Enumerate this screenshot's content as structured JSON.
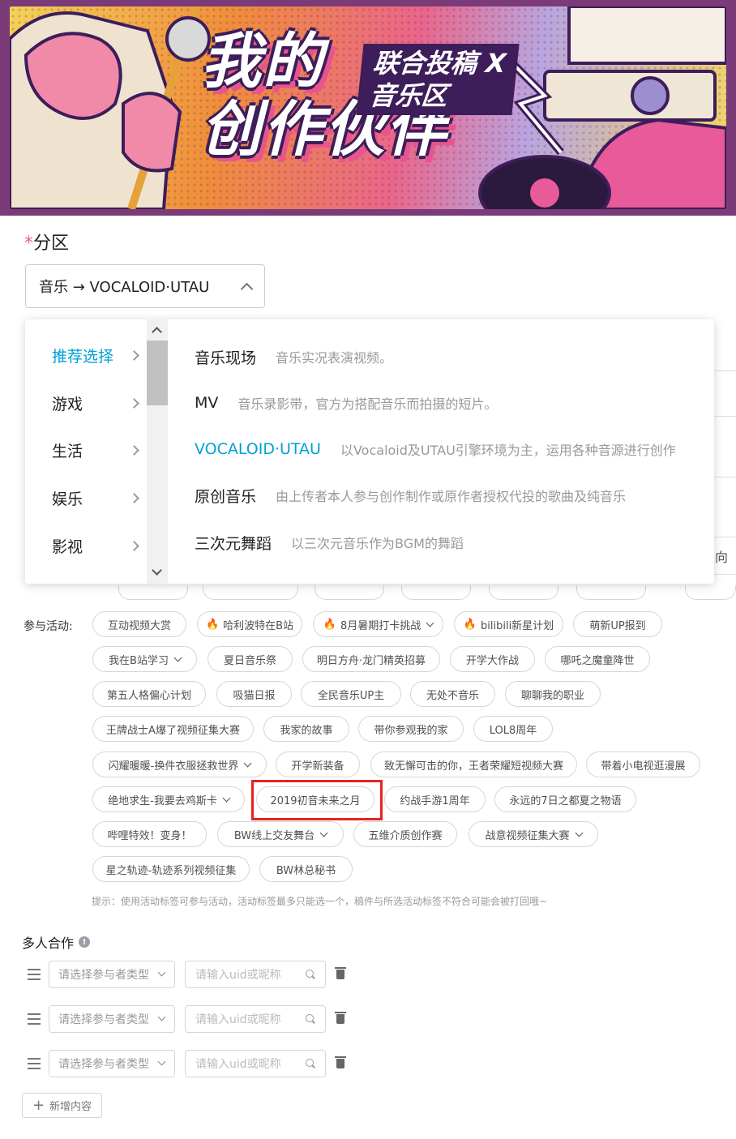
{
  "banner": {
    "title_main": "我的\n创作伙伴",
    "title_sub": "联合投稿 X\n音乐区"
  },
  "partition": {
    "required_mark": "*",
    "label": "分区",
    "selected_value": "音乐 → VOCALOID·UTAU"
  },
  "dropdown": {
    "categories": [
      {
        "label": "推荐选择",
        "active": true
      },
      {
        "label": "游戏",
        "active": false
      },
      {
        "label": "生活",
        "active": false
      },
      {
        "label": "娱乐",
        "active": false
      },
      {
        "label": "影视",
        "active": false
      }
    ],
    "subcategories": [
      {
        "name": "音乐现场",
        "desc": "音乐实况表演视频。"
      },
      {
        "name": "MV",
        "desc": "音乐录影带，官方为搭配音乐而拍摄的短片。"
      },
      {
        "name": "VOCALOID·UTAU",
        "desc": "以Vocaloid及UTAU引擎环境为主，运用各种音源进行创作",
        "active": true
      },
      {
        "name": "原创音乐",
        "desc": "由上传者本人参与创作制作或原作者授权代投的歌曲及纯音乐"
      },
      {
        "name": "三次元舞蹈",
        "desc": "以三次元音乐作为BGM的舞蹈"
      }
    ],
    "peek_text": "向"
  },
  "activities": {
    "label": "参与活动:",
    "tags": [
      {
        "label": "互动视频大赏",
        "fire": false,
        "dropdown": false
      },
      {
        "label": "哈利波特在B站",
        "fire": true,
        "dropdown": false
      },
      {
        "label": "8月暑期打卡挑战",
        "fire": true,
        "dropdown": true
      },
      {
        "label": "bilibili新星计划",
        "fire": true,
        "dropdown": false
      },
      {
        "label": "萌新UP报到",
        "fire": false,
        "dropdown": false
      },
      {
        "label": "我在B站学习",
        "fire": false,
        "dropdown": true
      },
      {
        "label": "夏日音乐祭",
        "fire": false,
        "dropdown": false
      },
      {
        "label": "明日方舟·龙门精英招募",
        "fire": false,
        "dropdown": false
      },
      {
        "label": "开学大作战",
        "fire": false,
        "dropdown": false
      },
      {
        "label": "哪吒之魔童降世",
        "fire": false,
        "dropdown": false
      },
      {
        "label": "第五人格偏心计划",
        "fire": false,
        "dropdown": false
      },
      {
        "label": "吸猫日报",
        "fire": false,
        "dropdown": false
      },
      {
        "label": "全民音乐UP主",
        "fire": false,
        "dropdown": false
      },
      {
        "label": "无处不音乐",
        "fire": false,
        "dropdown": false
      },
      {
        "label": "聊聊我的职业",
        "fire": false,
        "dropdown": false
      },
      {
        "label": "王牌战士A爆了视频征集大赛",
        "fire": false,
        "dropdown": false
      },
      {
        "label": "我家的故事",
        "fire": false,
        "dropdown": false
      },
      {
        "label": "带你参观我的家",
        "fire": false,
        "dropdown": false
      },
      {
        "label": "LOL8周年",
        "fire": false,
        "dropdown": false
      },
      {
        "label": "闪耀暖暖-换件衣服拯救世界",
        "fire": false,
        "dropdown": true
      },
      {
        "label": "开学新装备",
        "fire": false,
        "dropdown": false
      },
      {
        "label": "致无懈可击的你，王者荣耀短视频大赛",
        "fire": false,
        "dropdown": false
      },
      {
        "label": "带着小电视逛漫展",
        "fire": false,
        "dropdown": false
      },
      {
        "label": "绝地求生-我要去鸡斯卡",
        "fire": false,
        "dropdown": true
      },
      {
        "label": "2019初音未来之月",
        "fire": false,
        "dropdown": false
      },
      {
        "label": "约战手游1周年",
        "fire": false,
        "dropdown": false
      },
      {
        "label": "永远的7日之都夏之物语",
        "fire": false,
        "dropdown": false
      },
      {
        "label": "哔哩特效！变身！",
        "fire": false,
        "dropdown": false
      },
      {
        "label": "BW线上交友舞台",
        "fire": false,
        "dropdown": true
      },
      {
        "label": "五维介质创作赛",
        "fire": false,
        "dropdown": false
      },
      {
        "label": "战意视频征集大赛",
        "fire": false,
        "dropdown": true
      },
      {
        "label": "星之轨迹-轨迹系列视频征集",
        "fire": false,
        "dropdown": false
      },
      {
        "label": "BW林总秘书",
        "fire": false,
        "dropdown": false
      }
    ],
    "highlighted": "2019初音未来之月",
    "tip": "提示：使用活动标签可参与活动，活动标签最多只能选一个，稿件与所选活动标签不符合可能会被打回哦~"
  },
  "collab": {
    "title": "多人合作",
    "info_icon": "!",
    "rows": [
      {
        "type_placeholder": "请选择参与者类型",
        "uid_placeholder": "请输入uid或昵称"
      },
      {
        "type_placeholder": "请选择参与者类型",
        "uid_placeholder": "请输入uid或昵称"
      },
      {
        "type_placeholder": "请选择参与者类型",
        "uid_placeholder": "请输入uid或昵称"
      }
    ],
    "add_icon": "+",
    "add_label": "新增内容"
  },
  "colors": {
    "accent": "#00a1d6",
    "required": "#f45a8d",
    "fire": "#f25d2c",
    "highlight_box": "#e8231f"
  }
}
